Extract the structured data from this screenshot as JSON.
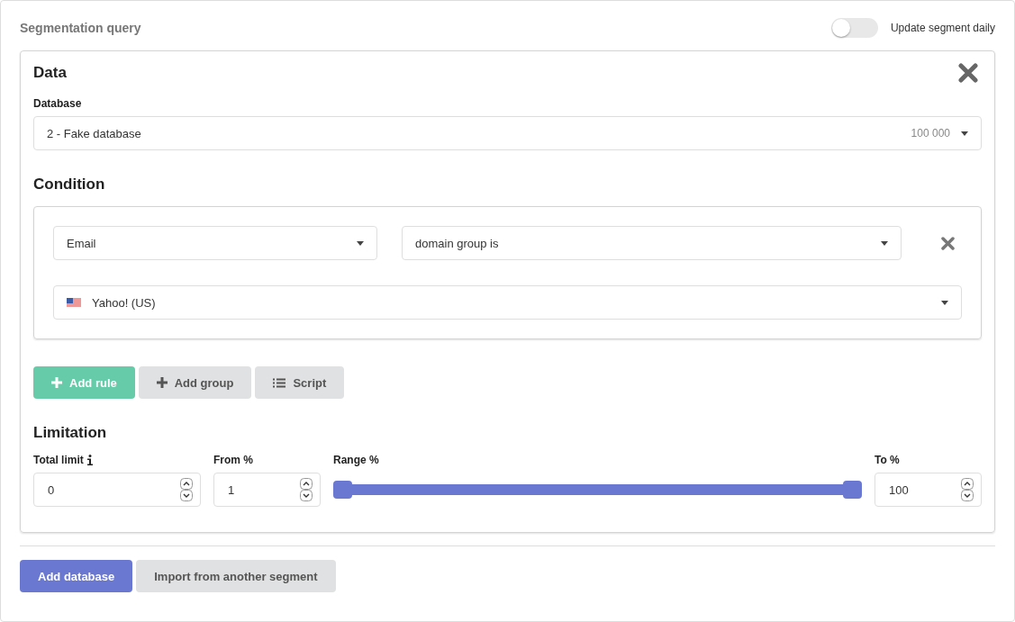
{
  "header": {
    "title": "Segmentation query",
    "toggle": {
      "label": "Update segment daily",
      "on": false
    }
  },
  "data_card": {
    "title": "Data",
    "database": {
      "label": "Database",
      "value": "2 - Fake database",
      "count": "100 000"
    },
    "condition": {
      "title": "Condition",
      "rules": [
        {
          "field": "Email",
          "operator": "domain group is",
          "value": "Yahoo! (US)"
        }
      ],
      "buttons": [
        {
          "kind": "rule",
          "label": "Add rule"
        },
        {
          "kind": "group",
          "label": "Add group"
        },
        {
          "kind": "script",
          "label": "Script"
        }
      ]
    },
    "limitation": {
      "title": "Limitation",
      "total_limit": {
        "label": "Total limit",
        "value": "0"
      },
      "from": {
        "label": "From %",
        "value": "1"
      },
      "range": {
        "label": "Range %",
        "level": 1
      },
      "to": {
        "label": "To %",
        "value": "100"
      }
    }
  },
  "footer_buttons": [
    {
      "kind": "primary",
      "label": "Add database"
    },
    {
      "kind": "secondary",
      "label": "Import from another segment"
    }
  ]
}
